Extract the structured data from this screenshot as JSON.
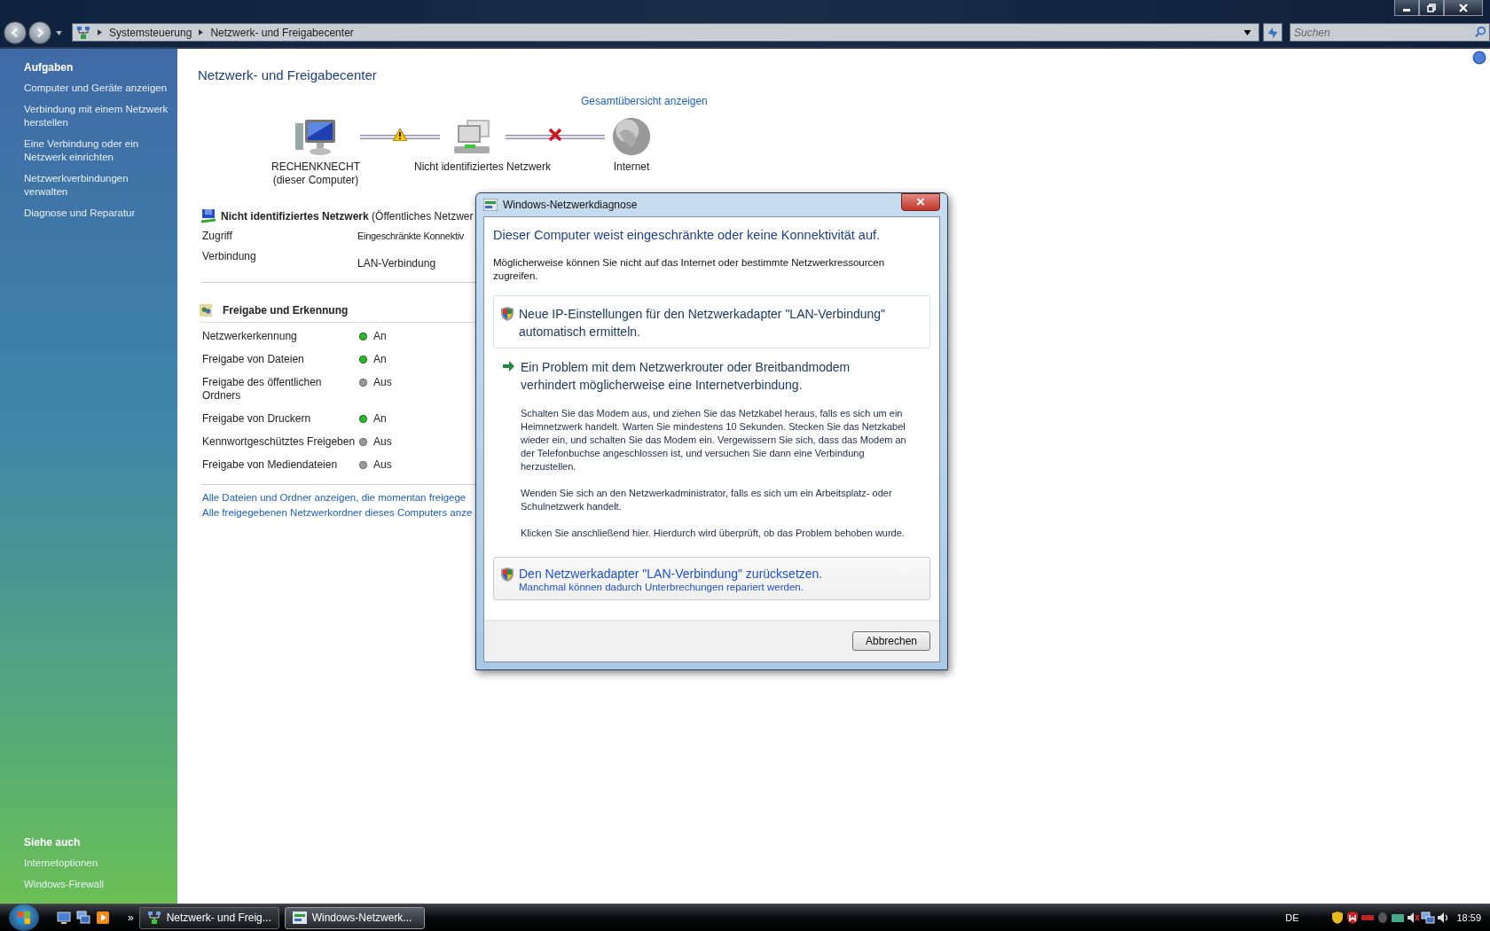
{
  "window": {
    "breadcrumb": [
      "Systemsteuerung",
      "Netzwerk- und Freigabecenter"
    ],
    "search": {
      "placeholder": "Suchen"
    }
  },
  "sidebar": {
    "tasks_heading": "Aufgaben",
    "tasks": [
      "Computer und Geräte anzeigen",
      "Verbindung mit einem Netzwerk herstellen",
      "Eine Verbindung oder ein Netzwerk einrichten",
      "Netzwerkverbindungen verwalten",
      "Diagnose und Reparatur"
    ],
    "see_also_heading": "Siehe auch",
    "see_also": [
      "Internetoptionen",
      "Windows-Firewall"
    ]
  },
  "main": {
    "title": "Netzwerk- und Freigabecenter",
    "overview_link": "Gesamtübersicht anzeigen",
    "map": {
      "nodes": [
        {
          "kind": "computer",
          "label": "RECHENKNECHT",
          "sublabel": "(dieser Computer)"
        },
        {
          "kind": "network",
          "label": "Nicht identifiziertes Netzwerk"
        },
        {
          "kind": "internet",
          "label": "Internet"
        }
      ],
      "links": [
        {
          "kind": "warning"
        },
        {
          "kind": "broken"
        }
      ]
    },
    "network": {
      "name": "Nicht identifiziertes Netzwerk",
      "type": "(Öffentliches Netzwer",
      "rows": [
        {
          "label": "Zugriff",
          "value": "Eingeschränkte Konnektiv"
        },
        {
          "label": "Verbindung",
          "value": "LAN-Verbindung"
        }
      ]
    },
    "sharing": {
      "heading": "Freigabe und Erkennung",
      "rows": [
        {
          "label": "Netzwerkerkennung",
          "value": "An",
          "on": true
        },
        {
          "label": "Freigabe von Dateien",
          "value": "An",
          "on": true
        },
        {
          "label": "Freigabe des öffentlichen Ordners",
          "value": "Aus",
          "on": false
        },
        {
          "label": "Freigabe von Druckern",
          "value": "An",
          "on": true
        },
        {
          "label": "Kennwortgeschütztes Freigeben",
          "value": "Aus",
          "on": false
        },
        {
          "label": "Freigabe von Mediendateien",
          "value": "Aus",
          "on": false
        }
      ]
    },
    "links": [
      "Alle Dateien und Ordner anzeigen, die momentan freigege",
      "Alle freigegebenen Netzwerkordner dieses Computers anze"
    ]
  },
  "dialog": {
    "title": "Windows-Netzwerkdiagnose",
    "heading": "Dieser Computer weist eingeschränkte oder keine Konnektivität auf.",
    "intro": "Möglicherweise können Sie nicht auf das Internet oder bestimmte Netzwerkressourcen zugreifen.",
    "options": [
      {
        "kind": "command",
        "hovered": true,
        "focused": false,
        "title": "Neue IP-Einstellungen für den Netzwerkadapter \"LAN-Verbindung\" automatisch ermitteln."
      },
      {
        "kind": "suggestion",
        "title": "Ein Problem mit dem Netzwerkrouter oder Breitbandmodem verhindert möglicherweise eine Internetverbindung.",
        "paragraphs": [
          "Schalten Sie das Modem aus, und ziehen Sie das Netzkabel heraus, falls es sich um ein Heimnetzwerk handelt. Warten Sie mindestens 10 Sekunden. Stecken Sie das Netzkabel wieder ein, und schalten Sie das Modem ein. Vergewissern Sie sich, dass das Modem an der Telefonbuchse angeschlossen ist, und versuchen Sie dann eine Verbindung herzustellen.",
          "Wenden Sie sich an den Netzwerkadministrator, falls es sich um ein Arbeitsplatz- oder Schulnetzwerk handelt.",
          "Klicken Sie anschließend hier. Hierdurch wird überprüft, ob das Problem behoben wurde."
        ]
      },
      {
        "kind": "command",
        "hovered": false,
        "focused": true,
        "title": "Den Netzwerkadapter \"LAN-Verbindung\" zurücksetzen.",
        "subtitle": "Manchmal können dadurch Unterbrechungen repariert werden."
      }
    ],
    "cancel": "Abbrechen"
  },
  "taskbar": {
    "more": "»",
    "tasks": [
      {
        "label": "Netzwerk- und Freig...",
        "kind": "explorer",
        "selected": false
      },
      {
        "label": "Windows-Netzwerk...",
        "kind": "dialog",
        "selected": true
      }
    ],
    "language": "DE",
    "clock": "18:59"
  }
}
